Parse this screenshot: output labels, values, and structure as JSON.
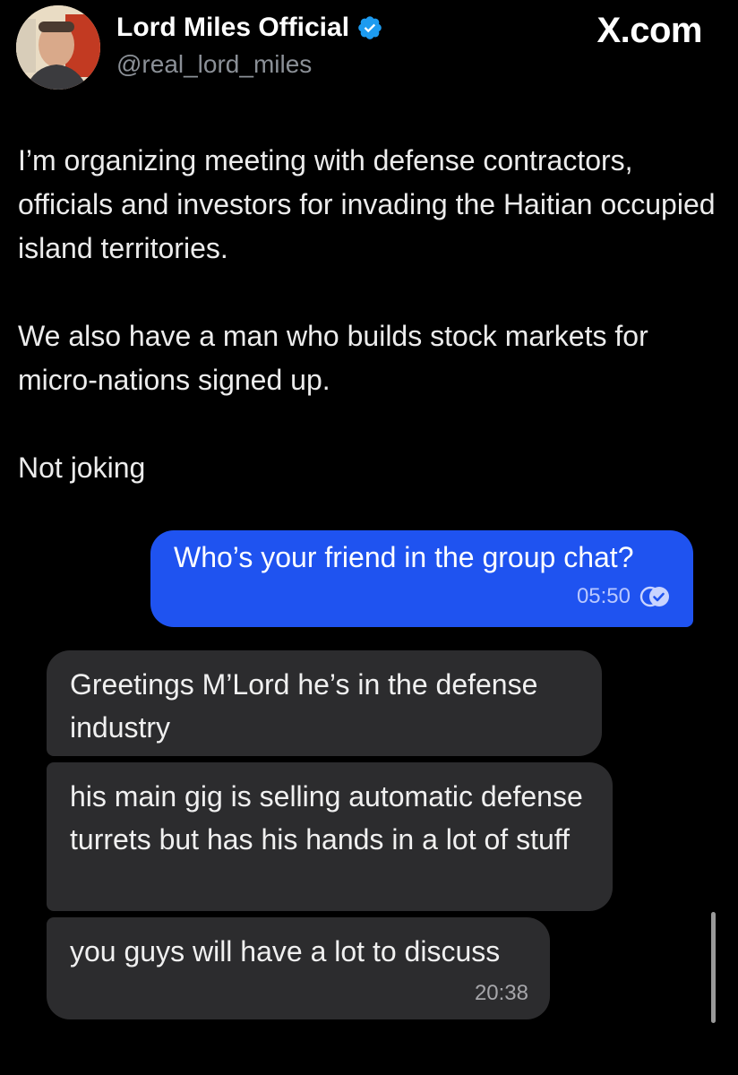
{
  "header": {
    "display_name": "Lord Miles Official",
    "handle": "@real_lord_miles",
    "verified": true,
    "brand": "X.com"
  },
  "tweet": {
    "paragraphs": [
      "I’m organizing meeting with defense contractors, officials and investors for invading the Haitian occupied island territories.",
      "We also have a man who builds stock markets for micro-nations signed up.",
      "Not joking"
    ]
  },
  "chat": {
    "outgoing": {
      "text": "Who’s your friend in the group chat?",
      "time": "05:50",
      "status_icon": "read-check-icon"
    },
    "incoming": [
      {
        "text": "Greetings M’Lord he’s in the defense industry"
      },
      {
        "text": "his main gig is selling automatic defense turrets but has his hands in a lot of stuff"
      },
      {
        "text": "you guys will have a lot to discuss",
        "time": "20:38"
      }
    ]
  },
  "colors": {
    "background": "#000000",
    "outgoing_bubble": "#1f53f0",
    "incoming_bubble": "#2c2c2e",
    "verified_badge": "#1d9bf0",
    "handle_text": "#8b9097"
  }
}
